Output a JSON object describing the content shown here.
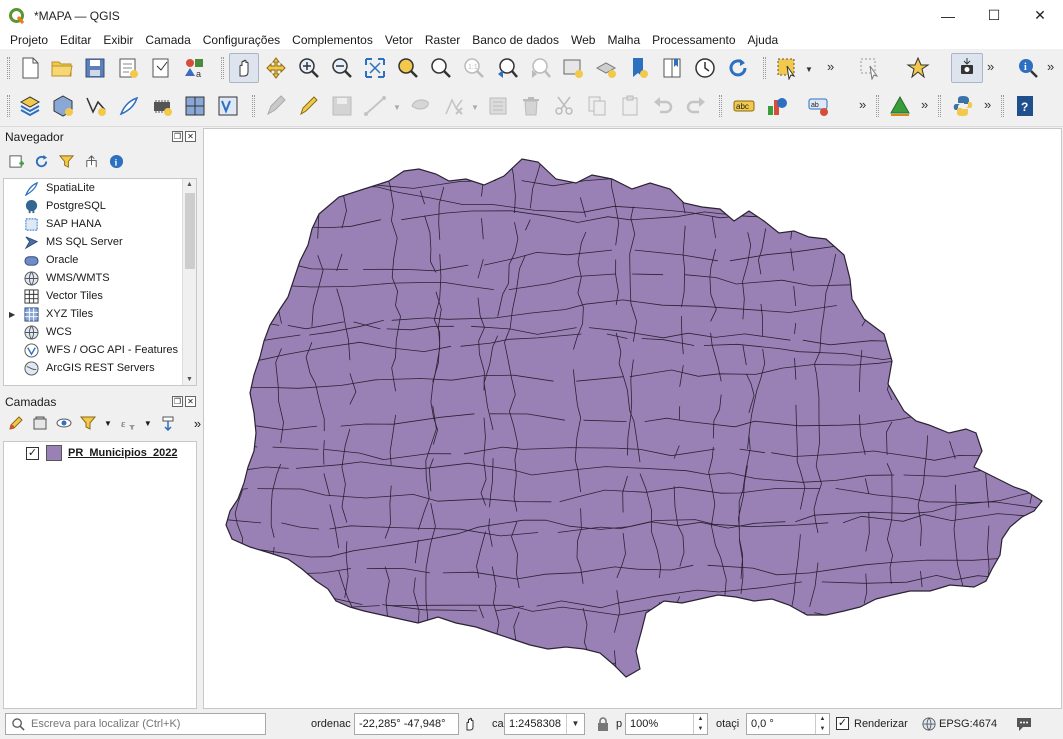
{
  "window": {
    "title": "*MAPA — QGIS",
    "minimize": "—",
    "maximize": "☐",
    "close": "✕"
  },
  "menubar": [
    "Projeto",
    "Editar",
    "Exibir",
    "Camada",
    "Configurações",
    "Complementos",
    "Vetor",
    "Raster",
    "Banco de dados",
    "Web",
    "Malha",
    "Processamento",
    "Ajuda"
  ],
  "overflow_glyph": "»",
  "navigator": {
    "title": "Navegador",
    "items": [
      "SpatiaLite",
      "PostgreSQL",
      "SAP HANA",
      "MS SQL Server",
      "Oracle",
      "WMS/WMTS",
      "Vector Tiles",
      "XYZ Tiles",
      "WCS",
      "WFS / OGC API - Features",
      "ArcGIS REST Servers"
    ]
  },
  "layers": {
    "title": "Camadas",
    "items": [
      {
        "name": "PR_Municipios_2022",
        "checked": "✓",
        "color": "#9a81b5"
      }
    ]
  },
  "statusbar": {
    "search_placeholder": "Escreva para localizar (Ctrl+K)",
    "coord_label": "ordenac",
    "coord_value": "-22,285° -47,948°",
    "scale_label": "ca",
    "scale_value": "1:2458308",
    "magnifier_label": "p",
    "magnifier_value": "100%",
    "rotation_label": "otaçi",
    "rotation_value": "0,0 °",
    "render_label": "Renderizar",
    "render_checked": "✓",
    "crs": "EPSG:4674"
  },
  "map": {
    "fill_color": "#9a81b5",
    "stroke_color": "#2b2233"
  }
}
